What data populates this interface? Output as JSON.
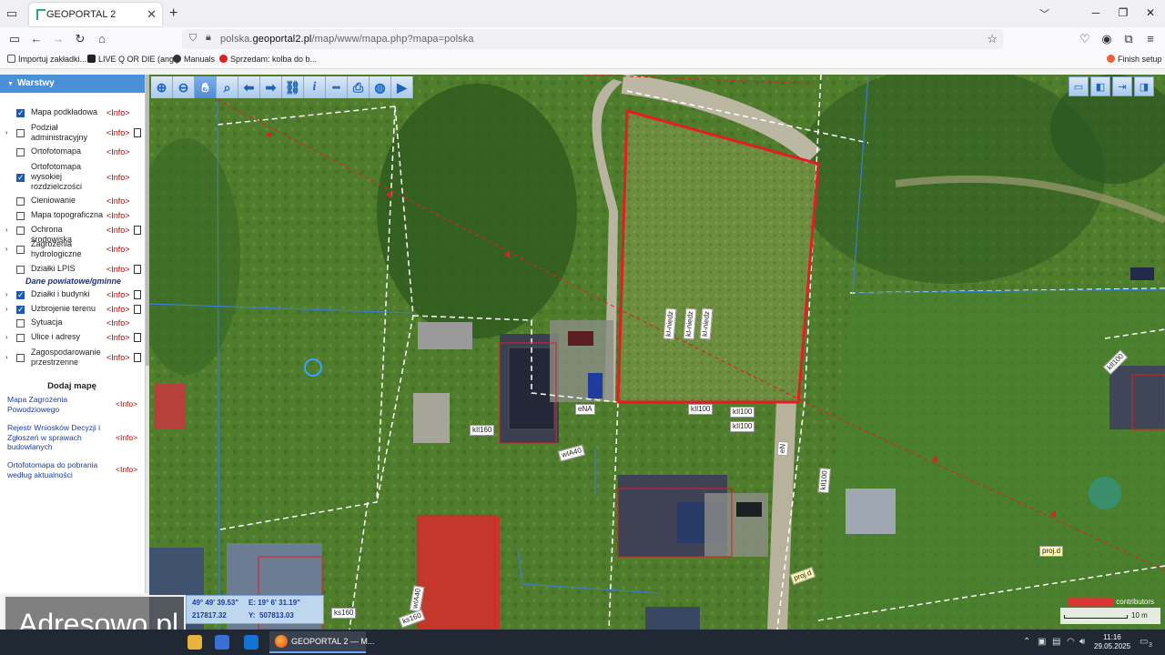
{
  "browser": {
    "tab_title": "GEOPORTAL 2",
    "url_prefix": "polska.",
    "url_domain": "geoportal2.pl",
    "url_path": "/map/www/mapa.php?mapa=polska",
    "bookmarks": [
      "Importuj zakładki...",
      "LIVE Q OR DIE (ang.)",
      "Manuals",
      "Sprzedam: kolba do b...",
      "Finish setup"
    ]
  },
  "panel": {
    "header": "Warstwy",
    "info_label": "<Info>",
    "layers": [
      {
        "name": "Mapa podkładowa",
        "checked": true,
        "expander": false,
        "doc": false
      },
      {
        "name": "Podział administracyjny",
        "checked": false,
        "expander": true,
        "doc": true
      },
      {
        "name": "Ortofotomapa",
        "checked": false,
        "expander": false,
        "doc": false
      },
      {
        "name": "Ortofotomapa wysokiej rozdzielczości",
        "checked": true,
        "expander": false,
        "doc": false
      },
      {
        "name": "Cieniowanie",
        "checked": false,
        "expander": false,
        "doc": false
      },
      {
        "name": "Mapa topograficzna",
        "checked": false,
        "expander": false,
        "doc": false
      },
      {
        "name": "Ochrona środowiska",
        "checked": false,
        "expander": true,
        "doc": true
      },
      {
        "name": "Zagrożenia hydrologiczne",
        "checked": false,
        "expander": true,
        "doc": false
      },
      {
        "name": "Działki LPIS",
        "checked": false,
        "expander": false,
        "doc": true
      }
    ],
    "section_title": "Dane powiatowe/gminne",
    "local_layers": [
      {
        "name": "Działki i budynki",
        "checked": true,
        "expander": true,
        "doc": true
      },
      {
        "name": "Uzbrojenie terenu",
        "checked": true,
        "expander": true,
        "doc": true
      },
      {
        "name": "Sytuacja",
        "checked": false,
        "expander": false,
        "doc": false
      },
      {
        "name": "Ulice i adresy",
        "checked": false,
        "expander": true,
        "doc": true
      },
      {
        "name": "Zagospodarowanie przestrzenne",
        "checked": false,
        "expander": true,
        "doc": true
      }
    ],
    "add_map_title": "Dodaj mapę",
    "extra_maps": [
      "Mapa Zagrożenia Powodziowego",
      "Rejestr Wniosków Decyzji i Zgłoszeń w sprawach budowlanych",
      "Ortofotomapa do pobrania według aktualności"
    ]
  },
  "map": {
    "labels": [
      "kIl100",
      "kIl100",
      "kIl100",
      "kIl100",
      "eNA",
      "eN",
      "kIl160",
      "wIA40",
      "wIA40",
      "ks160",
      "ks160",
      "proj.d",
      "proj.d",
      "kIl100"
    ],
    "rotated_labels": [
      "kI-niedz",
      "kI-niedz",
      "kI-niedz"
    ],
    "coords": {
      "lat": "49° 49' 39.53\"",
      "lon": "E: 19° 6' 31.19\"",
      "x": "217817.32",
      "y_label": "Y:",
      "y": "507813.03"
    },
    "watermark": "Adresowo.pl",
    "scale": "10 m",
    "attribution": "contributors"
  },
  "taskbar": {
    "firefox_label": "GEOPORTAL 2 — M...",
    "time": "11:16",
    "date": "29.05.2025",
    "notif_count": "3"
  }
}
